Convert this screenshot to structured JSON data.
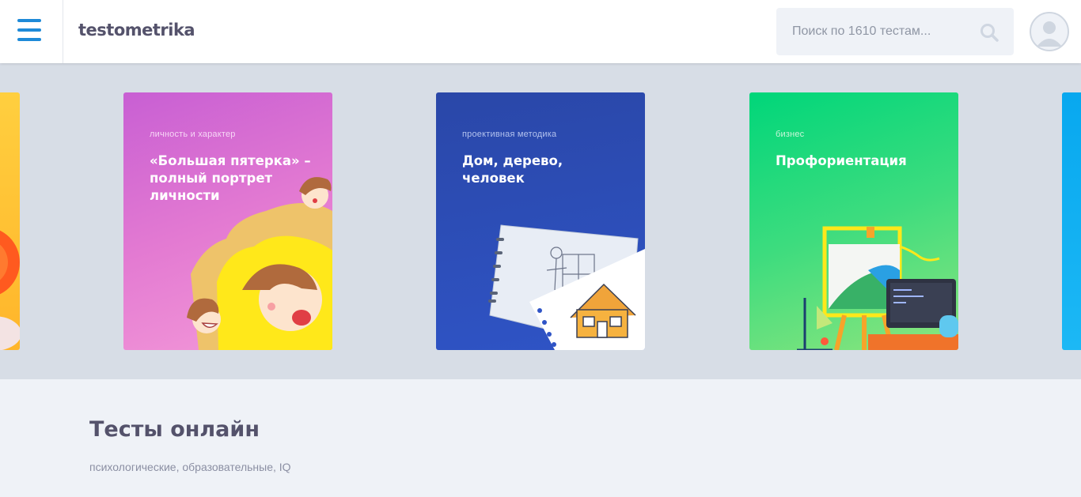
{
  "header": {
    "logo": "testometrika",
    "search_placeholder": "Поиск по 1610 тестам..."
  },
  "carousel": {
    "cards": [
      {
        "category": "личность и характер",
        "title": "«Большая пятерка» – полный портрет личности"
      },
      {
        "category": "проективная методика",
        "title": "Дом, дерево, человек"
      },
      {
        "category": "бизнес",
        "title": "Профориентация"
      }
    ]
  },
  "section": {
    "title": "Тесты онлайн",
    "subtitle": "психологические, образовательные, IQ"
  },
  "colors": {
    "accent": "#1e8ad8",
    "text_dark": "#54526b",
    "card_pink": "#d96ad4",
    "card_blue": "#2c4eb8",
    "card_green": "#2ed87c"
  },
  "icons": [
    "menu-icon",
    "search-icon",
    "user-avatar-icon"
  ]
}
